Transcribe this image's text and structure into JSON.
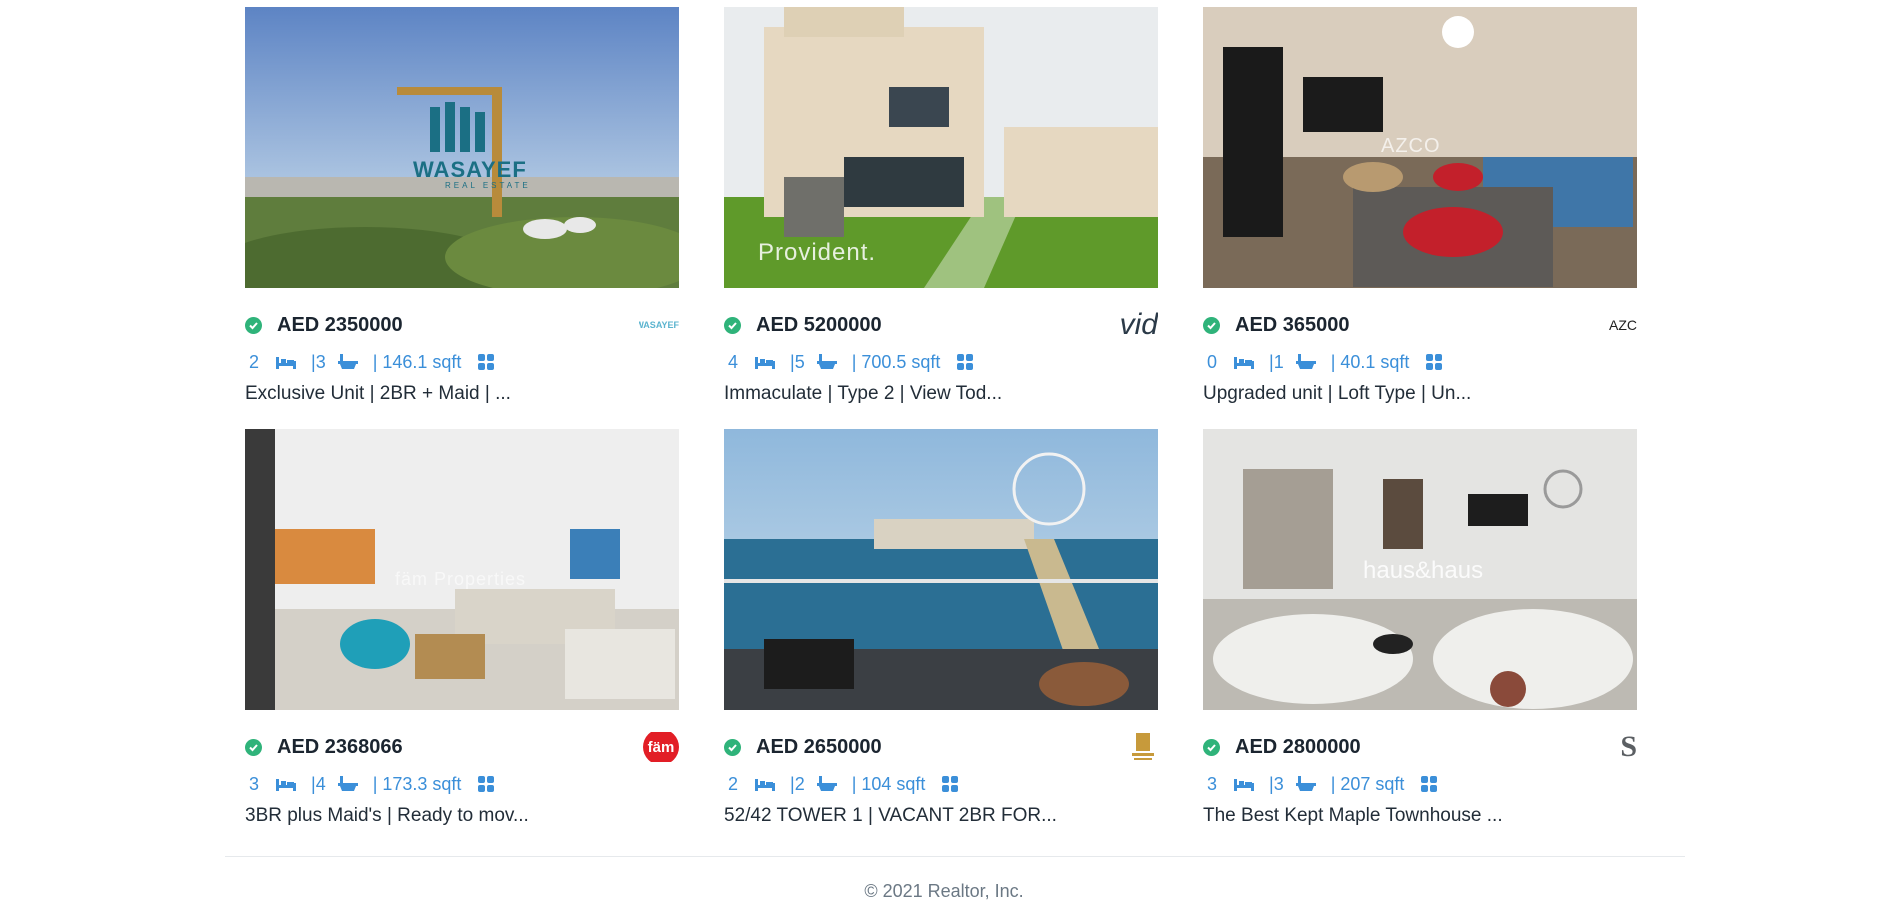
{
  "listings": [
    {
      "price": "AED 2350000",
      "beds": "2",
      "baths": "|3",
      "area": "| 146.1 sqft",
      "title": "Exclusive Unit | 2BR + Maid | ...",
      "photo_watermark": "WASAYEF",
      "photo_watermark_sub": "REAL ESTATE",
      "agency_logo_text": "WASAYEF"
    },
    {
      "price": "AED 5200000",
      "beds": "4",
      "baths": "|5",
      "area": "| 700.5 sqft",
      "title": "Immaculate | Type 2 | View Tod...",
      "photo_watermark": "Provident.",
      "agency_logo_text": "vid"
    },
    {
      "price": "AED 365000",
      "beds": "0",
      "baths": "|1",
      "area": "| 40.1 sqft",
      "title": "Upgraded unit | Loft Type | Un...",
      "photo_watermark": "AZCO",
      "agency_logo_text": "AZC"
    },
    {
      "price": "AED 2368066",
      "beds": "3",
      "baths": "|4",
      "area": "| 173.3 sqft",
      "title": "3BR plus Maid's | Ready to mov...",
      "photo_watermark": "fäm Properties",
      "agency_logo_text": "fäm"
    },
    {
      "price": "AED 2650000",
      "beds": "2",
      "baths": "|2",
      "area": "| 104 sqft",
      "title": "52/42 TOWER 1 | VACANT 2BR FOR...",
      "photo_watermark": "",
      "agency_logo_text": ""
    },
    {
      "price": "AED 2800000",
      "beds": "3",
      "baths": "|3",
      "area": "| 207 sqft",
      "title": "The Best Kept Maple Townhouse ...",
      "photo_watermark": "haus&haus",
      "agency_logo_text": "S"
    }
  ],
  "footer": {
    "copyright": "© 2021 Realtor, Inc."
  },
  "colors": {
    "accent": "#3b8fd9",
    "verified": "#2fb37a",
    "text": "#222d38"
  }
}
